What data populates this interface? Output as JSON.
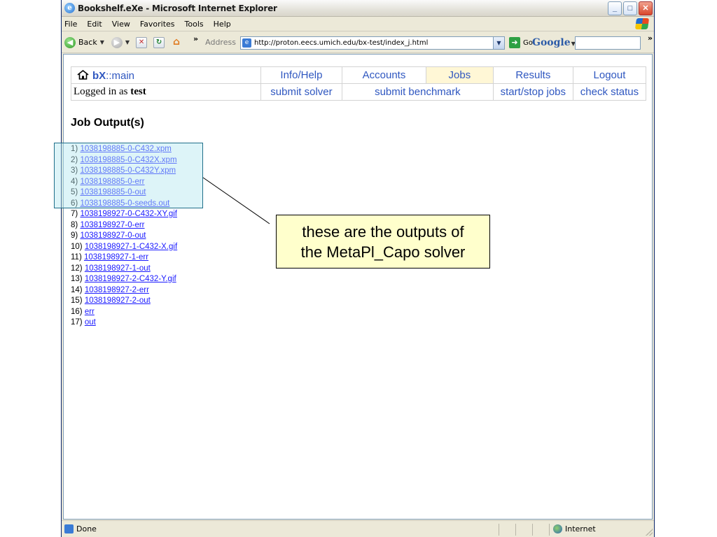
{
  "window": {
    "title": "Bookshelf.eXe - Microsoft Internet Explorer",
    "icon": "ie-icon"
  },
  "menu": [
    "File",
    "Edit",
    "View",
    "Favorites",
    "Tools",
    "Help"
  ],
  "toolbar": {
    "back_label": "Back",
    "address_label": "Address",
    "address_url": "http://proton.eecs.umich.edu/bx-test/index_j.html",
    "go_label": "Go",
    "search_brand": "Google",
    "search_value": ""
  },
  "page": {
    "logo_bold": "bX",
    "logo_rest": "::main",
    "logged_in_prefix": "Logged in as",
    "username": "test",
    "nav": {
      "info": "Info/Help",
      "accounts": "Accounts",
      "jobs": "Jobs",
      "results": "Results",
      "logout": "Logout"
    },
    "subnav": {
      "submit_solver": "submit solver",
      "submit_benchmark": "submit benchmark",
      "start_stop": "start/stop jobs",
      "check_status": "check status"
    },
    "heading": "Job Output(s)",
    "outputs": [
      {
        "num": "1)",
        "link": "1038198885-0-C432.xpm"
      },
      {
        "num": "2)",
        "link": "1038198885-0-C432X.xpm"
      },
      {
        "num": "3)",
        "link": "1038198885-0-C432Y.xpm"
      },
      {
        "num": "4)",
        "link": "1038198885-0-err"
      },
      {
        "num": "5)",
        "link": "1038198885-0-out"
      },
      {
        "num": "6)",
        "link": "1038198885-0-seeds.out"
      },
      {
        "num": "7)",
        "link": "1038198927-0-C432-XY.gif"
      },
      {
        "num": "8)",
        "link": "1038198927-0-err"
      },
      {
        "num": "9)",
        "link": "1038198927-0-out"
      },
      {
        "num": "10)",
        "link": "1038198927-1-C432-X.gif"
      },
      {
        "num": "11)",
        "link": "1038198927-1-err"
      },
      {
        "num": "12)",
        "link": "1038198927-1-out"
      },
      {
        "num": "13)",
        "link": "1038198927-2-C432-Y.gif"
      },
      {
        "num": "14)",
        "link": "1038198927-2-err"
      },
      {
        "num": "15)",
        "link": "1038198927-2-out"
      },
      {
        "num": "16)",
        "link": "err"
      },
      {
        "num": "17)",
        "link": "out"
      }
    ]
  },
  "status": {
    "left": "Done",
    "zone": "Internet"
  },
  "annotation": {
    "line1": "these are the outputs of",
    "line2": "the MetaPl_Capo solver"
  },
  "colors": {
    "link": "#1a1aff",
    "nav_text": "#2f57c0",
    "jobs_highlight": "#fff7d6",
    "callout_bg": "#ffffcc",
    "highlight_fill": "#b4e6f0"
  }
}
